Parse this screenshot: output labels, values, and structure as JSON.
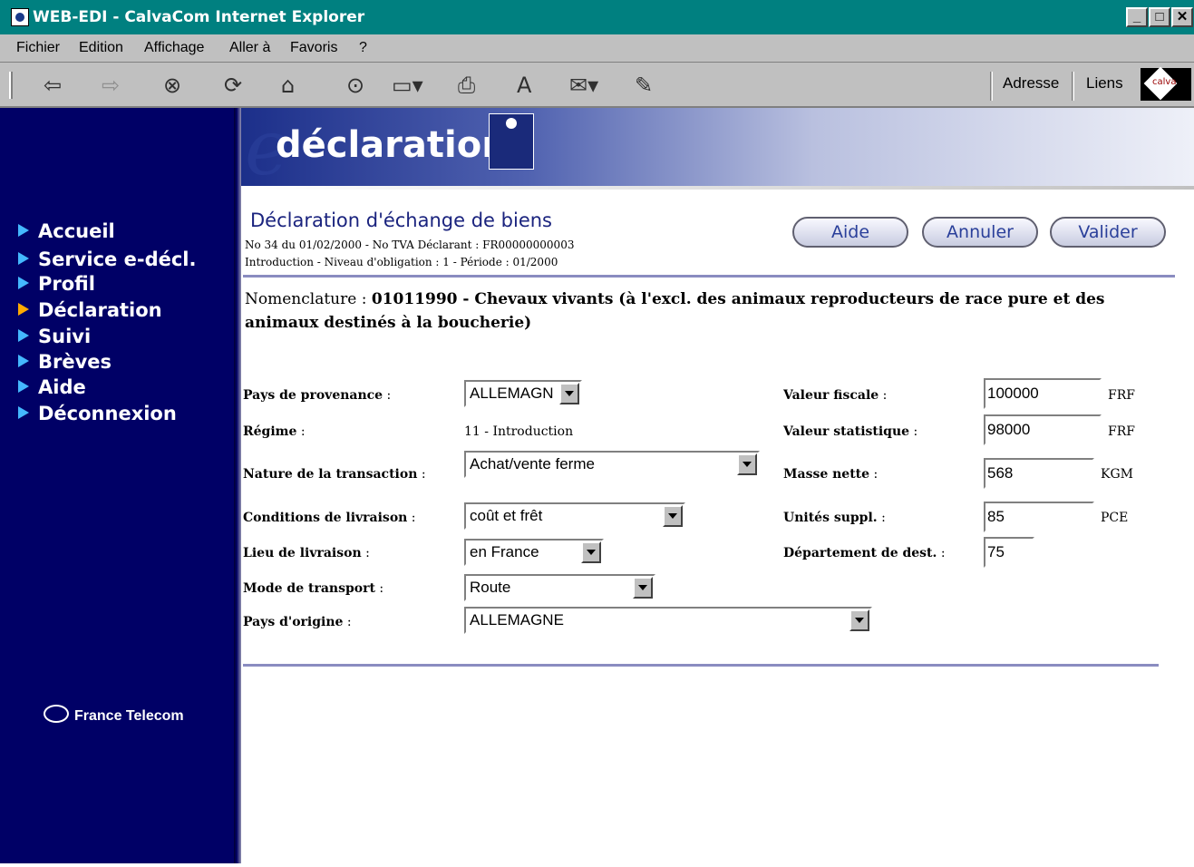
{
  "window": {
    "title": "WEB-EDI - CalvaCom Internet Explorer",
    "buttons": [
      "_",
      "□",
      "✕"
    ]
  },
  "menu": [
    "Fichier",
    "Edition",
    "Affichage",
    "Aller à",
    "Favoris",
    "?"
  ],
  "toolbar": {
    "address_label": "Adresse",
    "links_label": "Liens"
  },
  "sidebar": {
    "items": [
      {
        "label": "Accueil"
      },
      {
        "label": "Service e-décl."
      },
      {
        "label": "Profil"
      },
      {
        "label": "Déclaration",
        "active": true
      },
      {
        "label": "Suivi"
      },
      {
        "label": "Brèves"
      },
      {
        "label": "Aide"
      },
      {
        "label": "Déconnexion"
      }
    ],
    "footer_logo": "France Telecom"
  },
  "banner": {
    "title": "déclaration"
  },
  "header": {
    "title": "Déclaration d'échange de biens",
    "line1": "No 34 du 01/02/2000 - No TVA Déclarant : FR00000000003",
    "line2": "Introduction - Niveau d'obligation : 1 - Période : 01/2000"
  },
  "buttons": {
    "help": "Aide",
    "cancel": "Annuler",
    "validate": "Valider"
  },
  "nomenclature": {
    "label": "Nomenclature : ",
    "code_desc": "01011990 - Chevaux vivants (à l'excl. des animaux reproducteurs de race pure et des animaux destinés à la boucherie)"
  },
  "form": {
    "pays_provenance": {
      "label": "Pays de provenance",
      "value": "ALLEMAGN"
    },
    "regime": {
      "label": "Régime",
      "value": "11 - Introduction"
    },
    "nature_transaction": {
      "label": "Nature de la transaction",
      "value": "Achat/vente ferme"
    },
    "conditions_livraison": {
      "label": "Conditions de livraison",
      "value": "coût et frêt"
    },
    "lieu_livraison": {
      "label": "Lieu de livraison",
      "value": "en France"
    },
    "mode_transport": {
      "label": "Mode de transport",
      "value": "Route"
    },
    "pays_origine": {
      "label": "Pays d'origine",
      "value": "ALLEMAGNE"
    },
    "valeur_fiscale": {
      "label": "Valeur fiscale",
      "value": "100000",
      "unit": "FRF"
    },
    "valeur_statistique": {
      "label": "Valeur statistique",
      "value": "98000",
      "unit": "FRF"
    },
    "masse_nette": {
      "label": "Masse nette",
      "value": "568",
      "unit": "KGM"
    },
    "unites_suppl": {
      "label": "Unités suppl.",
      "value": "85",
      "unit": "PCE"
    },
    "departement_dest": {
      "label": "Département de dest.",
      "value": "75"
    }
  }
}
